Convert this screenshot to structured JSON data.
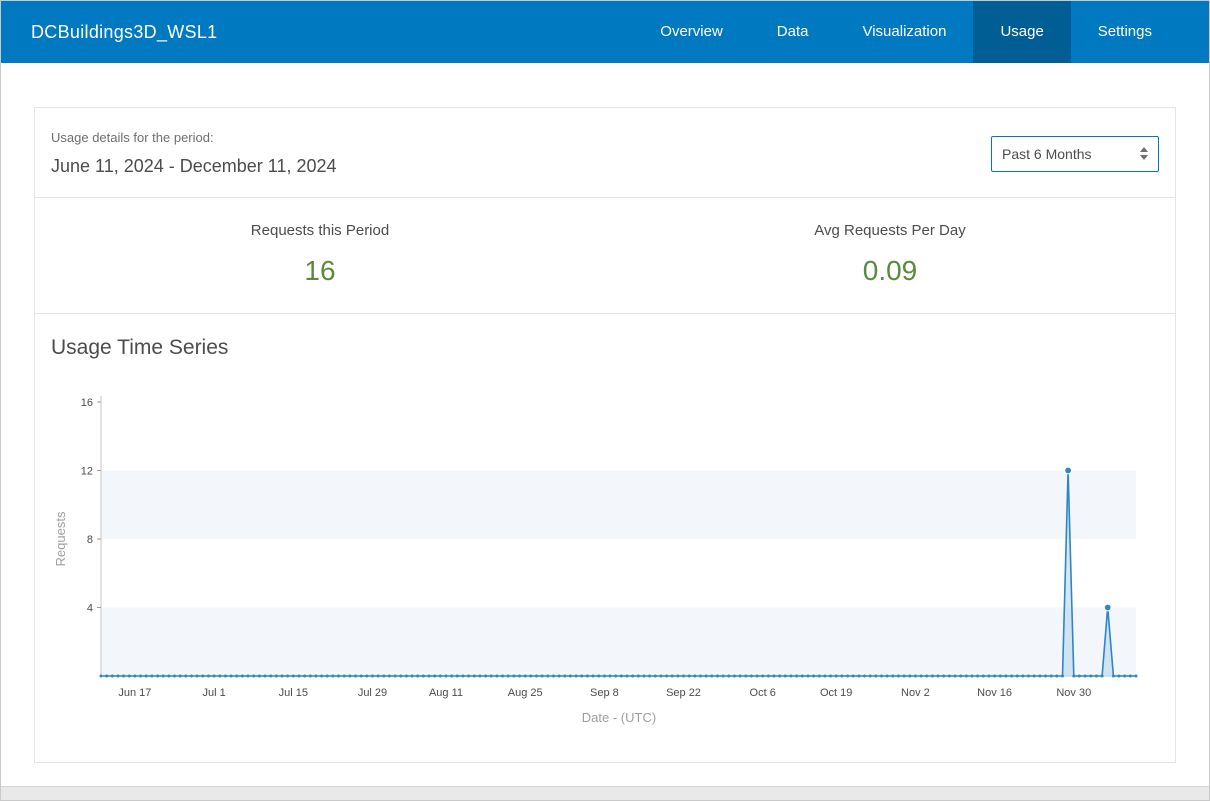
{
  "header": {
    "title": "DCBuildings3D_WSL1",
    "tabs": [
      {
        "label": "Overview",
        "active": false
      },
      {
        "label": "Data",
        "active": false
      },
      {
        "label": "Visualization",
        "active": false
      },
      {
        "label": "Usage",
        "active": true
      },
      {
        "label": "Settings",
        "active": false
      }
    ]
  },
  "usage": {
    "period_label": "Usage details for the period:",
    "period_range": "June 11, 2024 - December 11, 2024",
    "period_select_value": "Past 6 Months",
    "stats": [
      {
        "label": "Requests this Period",
        "value": "16"
      },
      {
        "label": "Avg Requests Per Day",
        "value": "0.09"
      }
    ]
  },
  "chart_data": {
    "type": "area",
    "title": "Usage Time Series",
    "xlabel": "Date - (UTC)",
    "ylabel": "Requests",
    "ylim": [
      0,
      16
    ],
    "y_ticks": [
      4,
      8,
      12,
      16
    ],
    "x_range": [
      "2024-06-11",
      "2024-12-11"
    ],
    "point_interval": "daily",
    "baseline_value": 0,
    "nonzero_points": [
      {
        "date": "2024-11-29",
        "value": 12
      },
      {
        "date": "2024-12-06",
        "value": 4
      }
    ],
    "x_ticks": [
      {
        "label": "Jun 17",
        "date": "2024-06-17"
      },
      {
        "label": "Jul 1",
        "date": "2024-07-01"
      },
      {
        "label": "Jul 15",
        "date": "2024-07-15"
      },
      {
        "label": "Jul 29",
        "date": "2024-07-29"
      },
      {
        "label": "Aug 11",
        "date": "2024-08-11"
      },
      {
        "label": "Aug 25",
        "date": "2024-08-25"
      },
      {
        "label": "Sep 8",
        "date": "2024-09-08"
      },
      {
        "label": "Sep 22",
        "date": "2024-09-22"
      },
      {
        "label": "Oct 6",
        "date": "2024-10-06"
      },
      {
        "label": "Oct 19",
        "date": "2024-10-19"
      },
      {
        "label": "Nov 2",
        "date": "2024-11-02"
      },
      {
        "label": "Nov 16",
        "date": "2024-11-16"
      },
      {
        "label": "Nov 30",
        "date": "2024-11-30"
      }
    ],
    "grid": "alternating-horizontal-bands",
    "legend": "none"
  },
  "colors": {
    "header_bg": "#0079c1",
    "active_tab_bg": "#005e95",
    "stat_green": "#5a8a3c",
    "chart_line": "#2e86c3",
    "chart_fill": "#b9d7ec",
    "chart_band": "#f3f6fa"
  }
}
